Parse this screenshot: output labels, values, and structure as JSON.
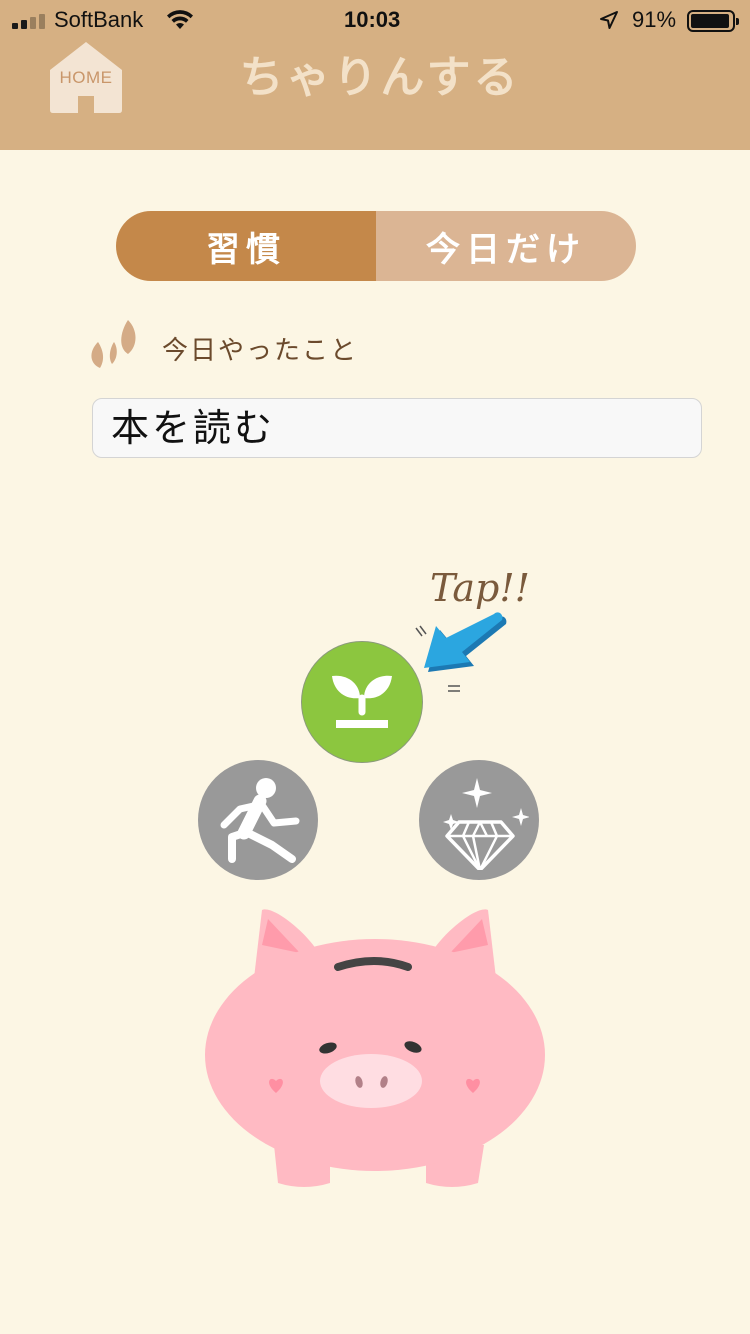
{
  "status_bar": {
    "carrier": "SoftBank",
    "time": "10:03",
    "battery": "91%",
    "battery_level": 0.91,
    "signal_bars_on": 2,
    "signal_bars_total": 4
  },
  "header": {
    "home_label": "HOME",
    "title": "ちゃりんする"
  },
  "segmented": {
    "items": [
      {
        "label": "習慣",
        "selected": true
      },
      {
        "label": "今日だけ",
        "selected": false
      }
    ]
  },
  "section": {
    "label": "今日やったこと"
  },
  "task_input": {
    "value": "本を読む",
    "placeholder": ""
  },
  "hint": {
    "tap": "Tap!!"
  },
  "categories": [
    {
      "name": "habit",
      "icon": "sprout-icon",
      "selected": true
    },
    {
      "name": "exercise",
      "icon": "running-person-icon",
      "selected": false
    },
    {
      "name": "treasure",
      "icon": "sparkle-diamond-icon",
      "selected": false
    }
  ],
  "colors": {
    "background": "#fcf6e4",
    "header": "#d6b083",
    "segment_active": "#c4884a",
    "segment_inactive": "#dbb594",
    "category_selected": "#8cc63f",
    "category_idle": "#999999",
    "pig": "#ffb9c3",
    "arrow": "#2b9fdc"
  }
}
